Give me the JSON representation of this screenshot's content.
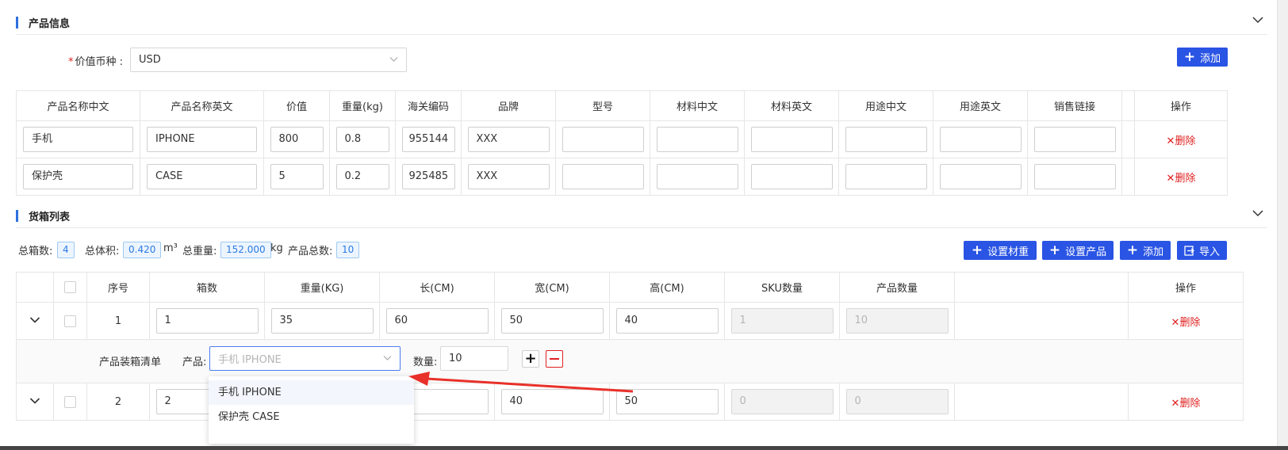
{
  "product_section": {
    "title": "产品信息",
    "currency_label": "价值币种 :",
    "currency_value": "USD",
    "add_label": "添加"
  },
  "product_table": {
    "headers": [
      "产品名称中文",
      "产品名称英文",
      "价值",
      "重量(kg)",
      "海关编码",
      "品牌",
      "型号",
      "材料中文",
      "材料英文",
      "用途中文",
      "用途英文",
      "销售链接",
      "",
      "操作"
    ],
    "rows": [
      {
        "name_cn": "手机",
        "name_en": "IPHONE",
        "value": "800",
        "weight": "0.8",
        "hs_code": "955144",
        "brand": "XXX",
        "model": "",
        "material_cn": "",
        "material_en": "",
        "use_cn": "",
        "use_en": "",
        "link": ""
      },
      {
        "name_cn": "保护壳",
        "name_en": "CASE",
        "value": "5",
        "weight": "0.2",
        "hs_code": "925485",
        "brand": "XXX",
        "model": "",
        "material_cn": "",
        "material_en": "",
        "use_cn": "",
        "use_en": "",
        "link": ""
      }
    ],
    "delete_label": "删除"
  },
  "box_section": {
    "title": "货箱列表",
    "total_boxes_label": "总箱数:",
    "total_boxes": "4",
    "total_volume_label": "总体积:",
    "total_volume": "0.420",
    "volume_unit": "m³",
    "total_weight_label": "总重量:",
    "total_weight": "152.000",
    "weight_unit": "kg",
    "total_products_label": "产品总数:",
    "total_products": "10",
    "buttons": {
      "set_size": "设置材重",
      "set_product": "设置产品",
      "add": "添加",
      "import": "导入"
    }
  },
  "box_table": {
    "headers": [
      "",
      "",
      "序号",
      "箱数",
      "重量(KG)",
      "长(CM)",
      "宽(CM)",
      "高(CM)",
      "SKU数量",
      "产品数量",
      "",
      "操作"
    ],
    "rows": [
      {
        "index": "1",
        "boxes": "1",
        "weight": "35",
        "length": "60",
        "width": "50",
        "height": "40",
        "sku_qty": "1",
        "product_qty": "10"
      },
      {
        "index": "2",
        "boxes": "2",
        "weight": "",
        "length": "",
        "width": "40",
        "height": "50",
        "sku_qty": "0",
        "product_qty": "0"
      }
    ],
    "delete_label": "删除",
    "packing": {
      "label": "产品装箱清单",
      "product_label": "产品:",
      "product_value": "手机 IPHONE",
      "qty_label": "数量:",
      "qty_value": "10"
    }
  },
  "dropdown": {
    "options": [
      "手机 IPHONE",
      "保护壳 CASE"
    ]
  },
  "colors": {
    "primary": "#2a54e4",
    "accent_bar": "#2f6fde",
    "danger": "#e02020",
    "arrow": "#e8312a"
  }
}
